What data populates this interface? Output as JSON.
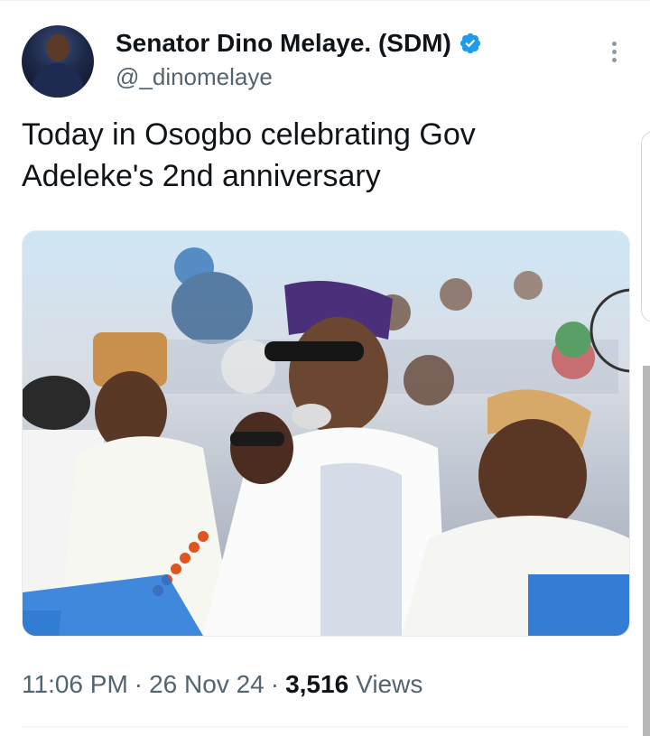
{
  "author": {
    "display_name": "Senator Dino Melaye. (SDM)",
    "handle": "@_dinomelaye",
    "verified": true
  },
  "tweet": {
    "text_line1": "Today in Osogbo celebrating Gov",
    "text_line2": "Adeleke's 2nd anniversary"
  },
  "meta": {
    "time": "11:06 PM",
    "separator": "·",
    "date": "26 Nov 24",
    "views_count": "3,516",
    "views_label": "Views"
  },
  "icons": {
    "verified": "verified-badge-icon",
    "more": "more-options-icon"
  },
  "colors": {
    "text": "#0f1419",
    "muted": "#536471",
    "verified_blue": "#1d9bf0"
  }
}
